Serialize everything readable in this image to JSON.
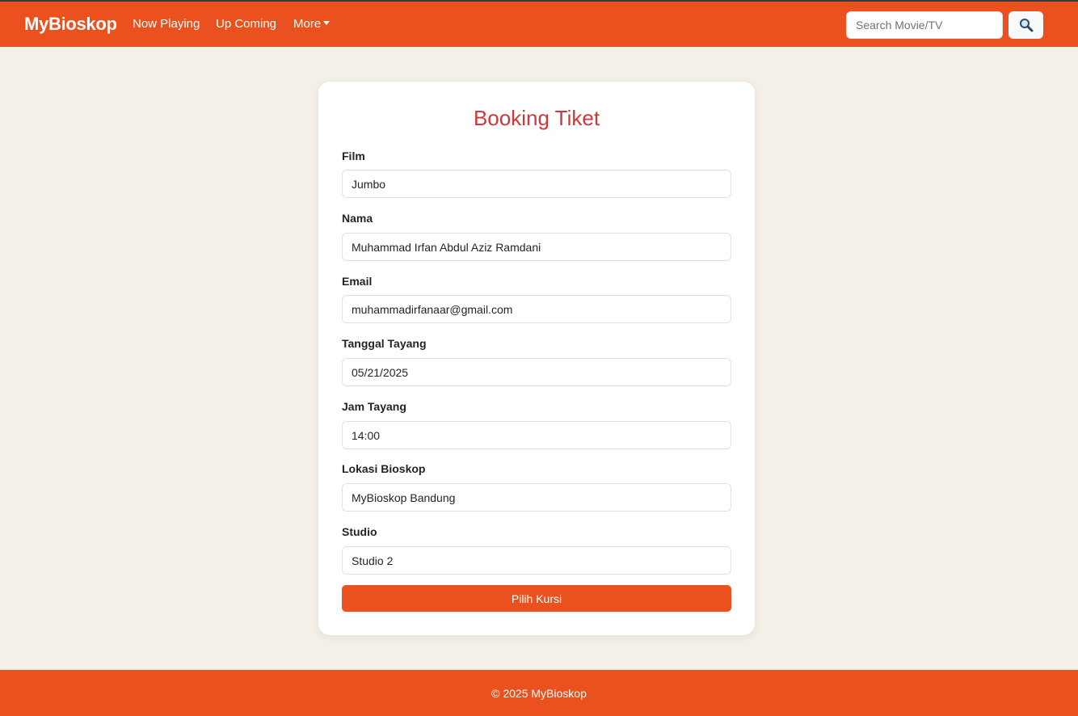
{
  "navbar": {
    "brand": "MyBioskop",
    "links": [
      "Now Playing",
      "Up Coming",
      "More"
    ],
    "search_placeholder": "Search Movie/TV",
    "search_icon": "magnifying-glass-icon",
    "color": "#ea511e"
  },
  "form": {
    "title": "Booking Tiket",
    "fields": [
      {
        "label": "Film",
        "value": "Jumbo"
      },
      {
        "label": "Nama",
        "value": "Muhammad Irfan Abdul Aziz Ramdani"
      },
      {
        "label": "Email",
        "value": "muhammadirfanaar@gmail.com"
      },
      {
        "label": "Tanggal Tayang",
        "value": "05/21/2025"
      },
      {
        "label": "Jam Tayang",
        "value": "14:00"
      },
      {
        "label": "Lokasi Bioskop",
        "value": "MyBioskop Bandung"
      },
      {
        "label": "Studio",
        "value": "Studio 2"
      }
    ],
    "submit_label": "Pilih Kursi"
  },
  "footer": {
    "text": "© 2025 MyBioskop"
  }
}
